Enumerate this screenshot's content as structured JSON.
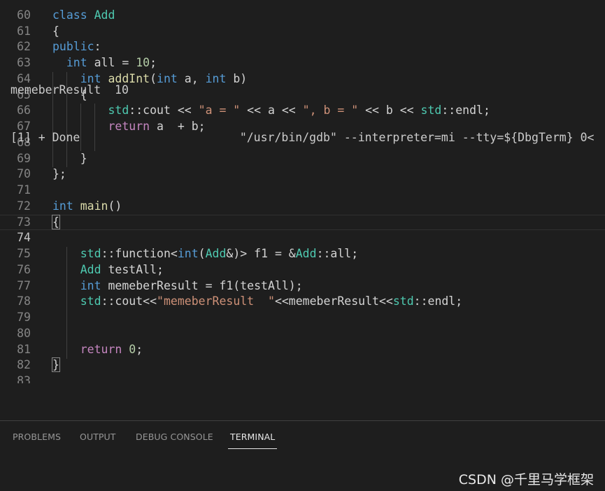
{
  "editor": {
    "current_line": "74",
    "lines": [
      {
        "n": "60",
        "code": ""
      },
      {
        "n": "61",
        "code": "class Add"
      },
      {
        "n": "62",
        "code": "{"
      },
      {
        "n": "63",
        "code": "public:"
      },
      {
        "n": "64",
        "code": "  int all = 10;"
      },
      {
        "n": "65",
        "code": "    int addInt(int a, int b)"
      },
      {
        "n": "66",
        "code": "    {"
      },
      {
        "n": "67",
        "code": "        std::cout << \"a = \" << a << \", b = \" << b << std::endl;"
      },
      {
        "n": "68",
        "code": "        return a  + b;"
      },
      {
        "n": "69",
        "code": ""
      },
      {
        "n": "70",
        "code": "    }"
      },
      {
        "n": "71",
        "code": "};"
      },
      {
        "n": "72",
        "code": ""
      },
      {
        "n": "73",
        "code": "int main()"
      },
      {
        "n": "74",
        "code": "{"
      },
      {
        "n": "75",
        "code": ""
      },
      {
        "n": "76",
        "code": "    std::function<int(Add&)> f1 = &Add::all;"
      },
      {
        "n": "77",
        "code": "    Add testAll;"
      },
      {
        "n": "78",
        "code": "    int memeberResult = f1(testAll);"
      },
      {
        "n": "79",
        "code": "    std::cout<<\"memeberResult  \"<<memeberResult<<std::endl;"
      },
      {
        "n": "80",
        "code": ""
      },
      {
        "n": "81",
        "code": ""
      },
      {
        "n": "82",
        "code": "    return 0;"
      },
      {
        "n": "83",
        "code": "}"
      }
    ]
  },
  "panel": {
    "tabs": [
      {
        "label": "PROBLEMS",
        "active": false
      },
      {
        "label": "OUTPUT",
        "active": false
      },
      {
        "label": "DEBUG CONSOLE",
        "active": false
      },
      {
        "label": "TERMINAL",
        "active": true
      }
    ],
    "terminal_lines": [
      "memeberResult  10",
      "[1] + Done                       \"/usr/bin/gdb\" --interpreter=mi --tty=${DbgTerm} 0<"
    ]
  },
  "watermark": "CSDN @千里马学框架"
}
